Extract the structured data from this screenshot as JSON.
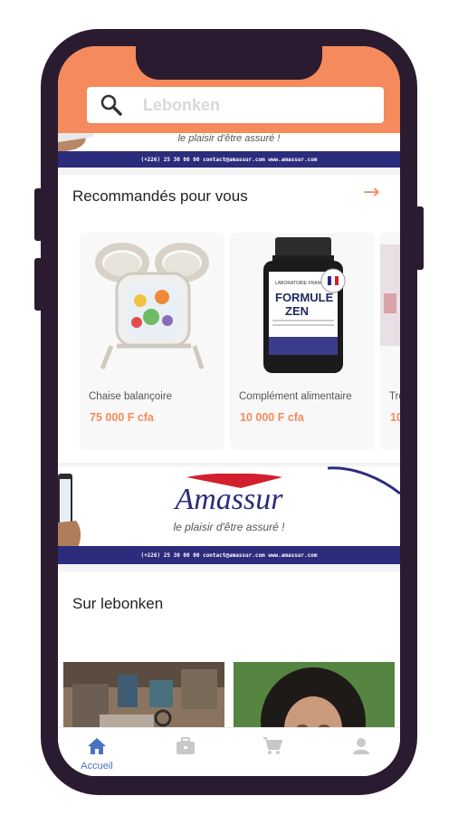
{
  "search": {
    "placeholder": "Lebonken",
    "icon": "search-icon"
  },
  "banner": {
    "brand": "Amassur",
    "tagline": "le plaisir d'être assuré !",
    "contact": "(+226) 25 30 00 00   contact@amassur.com   www.amassur.com",
    "colors": {
      "navy": "#2b2c7c",
      "red": "#d3202f"
    }
  },
  "recommended": {
    "title": "Recommandés pour vous",
    "arrow_icon": "arrow-right-icon",
    "products": [
      {
        "name": "Chaise balançoire",
        "price": "75 000 F cfa"
      },
      {
        "name": "Complément alimentaire",
        "price": "10 000 F cfa",
        "label_lines": [
          "FORMULE",
          "ZEN"
        ]
      },
      {
        "name": "Tro",
        "price": "10"
      }
    ]
  },
  "sur": {
    "title": "Sur lebonken"
  },
  "tabs": [
    {
      "label": "Accueil",
      "icon": "home-icon",
      "active": true
    },
    {
      "label": "",
      "icon": "briefcase-icon",
      "active": false
    },
    {
      "label": "",
      "icon": "cart-icon",
      "active": false
    },
    {
      "label": "",
      "icon": "user-icon",
      "active": false
    }
  ],
  "colors": {
    "accent": "#f58a5c",
    "phone_frame": "#2b1b30",
    "tab_active": "#4a72c0",
    "tab_inactive": "#c8c8c8"
  }
}
